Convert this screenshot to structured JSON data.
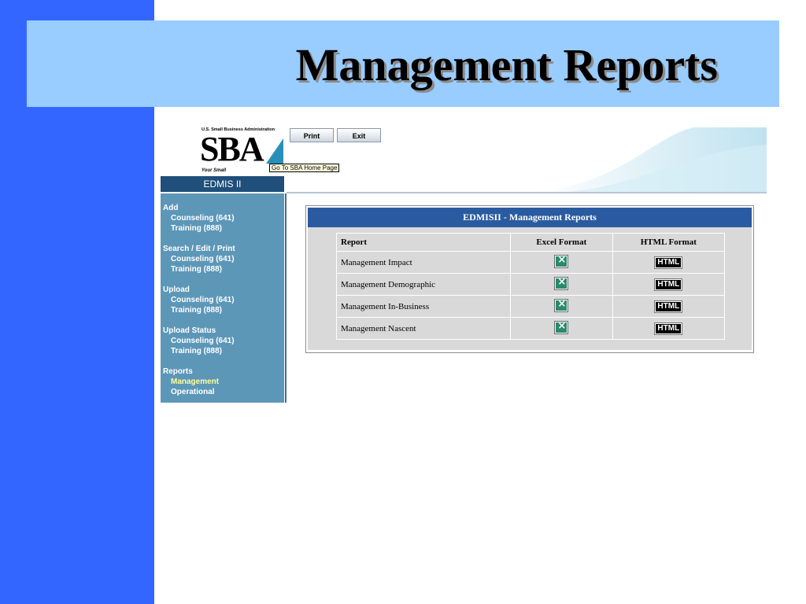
{
  "slide": {
    "title": "Management Reports",
    "band_color": "#3366ff",
    "banner_color": "#99ccff"
  },
  "logo": {
    "caption": "U.S. Small Business Administration",
    "text": "SBA",
    "tagline": "Your Small",
    "tooltip": "Go To SBA Home Page"
  },
  "toolbar": {
    "print_label": "Print",
    "exit_label": "Exit"
  },
  "nav": {
    "title": "EDMIS II",
    "groups": [
      {
        "heading": "Add",
        "items": [
          {
            "label": "Counseling (641)"
          },
          {
            "label": "Training (888)"
          }
        ]
      },
      {
        "heading": "Search / Edit / Print",
        "items": [
          {
            "label": "Counseling (641)"
          },
          {
            "label": "Training (888)"
          }
        ]
      },
      {
        "heading": "Upload",
        "items": [
          {
            "label": "Counseling (641)"
          },
          {
            "label": "Training (888)"
          }
        ]
      },
      {
        "heading": "Upload Status",
        "items": [
          {
            "label": "Counseling (641)"
          },
          {
            "label": "Training (888)"
          }
        ]
      },
      {
        "heading": "Reports",
        "items": [
          {
            "label": "Management",
            "active": true
          },
          {
            "label": "Operational"
          }
        ]
      }
    ]
  },
  "report_panel": {
    "title": "EDMISII - Management Reports",
    "headers": {
      "report": "Report",
      "excel": "Excel Format",
      "html": "HTML Format"
    },
    "html_badge": "HTML",
    "rows": [
      {
        "report": "Management Impact"
      },
      {
        "report": "Management Demographic"
      },
      {
        "report": "Management In-Business"
      },
      {
        "report": "Management Nascent"
      }
    ]
  }
}
